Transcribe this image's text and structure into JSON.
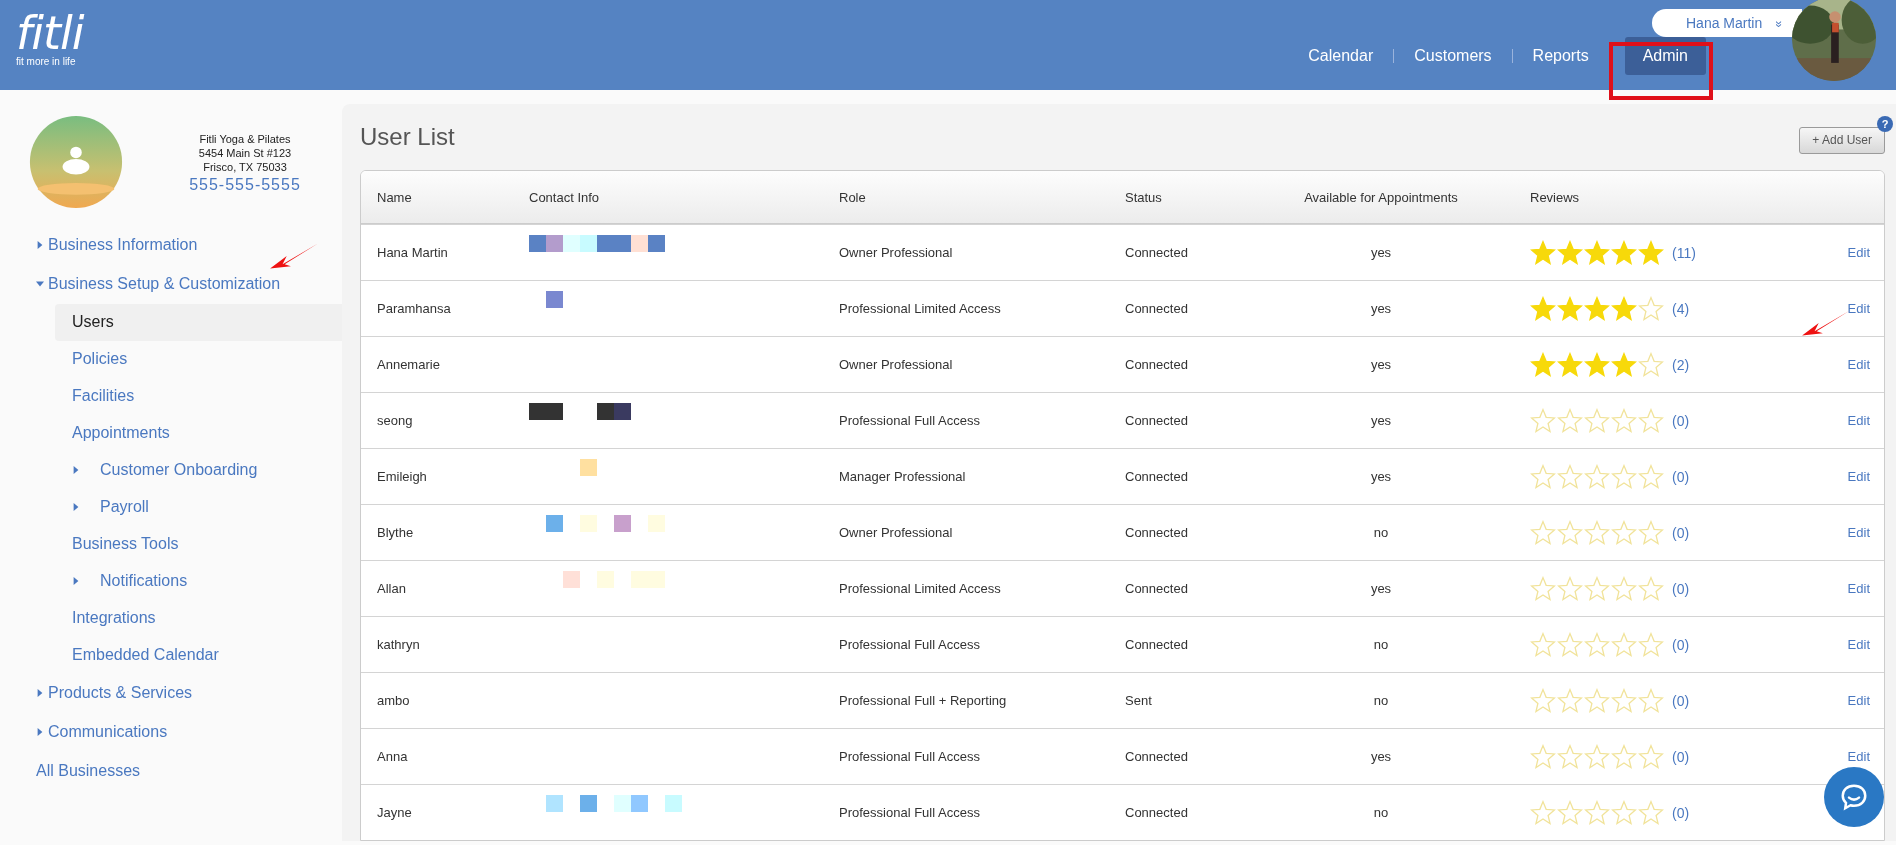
{
  "header": {
    "logo": "fitli",
    "tagline": "fit more in life",
    "user": "Hana Martin",
    "user_caret": "»",
    "nav": [
      {
        "label": "Calendar",
        "selected": false
      },
      {
        "label": "Customers",
        "selected": false
      },
      {
        "label": "Reports",
        "selected": false
      },
      {
        "label": "Admin",
        "selected": true
      }
    ]
  },
  "business": {
    "name": "Fitli Yoga & Pilates",
    "address": "5454 Main St #123",
    "city": "Frisco, TX 75033",
    "phone": "555-555-5555"
  },
  "sidebar": {
    "items": [
      {
        "label": "Business Information",
        "kind": "group",
        "expanded": false,
        "selected": false
      },
      {
        "label": "Business Setup & Customization",
        "kind": "group",
        "expanded": true,
        "selected": false,
        "children": [
          {
            "label": "Users",
            "kind": "link",
            "selected": true
          },
          {
            "label": "Policies",
            "kind": "link",
            "selected": false
          },
          {
            "label": "Facilities",
            "kind": "link",
            "selected": false
          },
          {
            "label": "Appointments",
            "kind": "link",
            "selected": false
          },
          {
            "label": "Customer Onboarding",
            "kind": "group",
            "expanded": false,
            "selected": false
          },
          {
            "label": "Payroll",
            "kind": "group",
            "expanded": false,
            "selected": false
          },
          {
            "label": "Business Tools",
            "kind": "link",
            "selected": false
          },
          {
            "label": "Notifications",
            "kind": "group",
            "expanded": false,
            "selected": false
          },
          {
            "label": "Integrations",
            "kind": "link",
            "selected": false
          },
          {
            "label": "Embedded Calendar",
            "kind": "link",
            "selected": false
          }
        ]
      },
      {
        "label": "Products & Services",
        "kind": "group",
        "expanded": false,
        "selected": false
      },
      {
        "label": "Communications",
        "kind": "group",
        "expanded": false,
        "selected": false
      },
      {
        "label": "All Businesses",
        "kind": "link",
        "selected": false
      }
    ]
  },
  "page": {
    "title": "User List",
    "add_button": "+ Add User",
    "help": "?"
  },
  "table": {
    "columns": [
      "Name",
      "Contact Info",
      "Role",
      "Status",
      "Available for Appointments",
      "Reviews"
    ],
    "rows": [
      {
        "name": "Hana Martin",
        "role": "Owner Professional",
        "status": "Connected",
        "available": "yes",
        "stars": 5,
        "count": "(11)",
        "action": "Edit"
      },
      {
        "name": "Paramhansa",
        "role": "Professional Limited Access",
        "status": "Connected",
        "available": "yes",
        "stars": 4,
        "count": "(4)",
        "action": "Edit"
      },
      {
        "name": "Annemarie",
        "role": "Owner Professional",
        "status": "Connected",
        "available": "yes",
        "stars": 4,
        "count": "(2)",
        "action": "Edit"
      },
      {
        "name": "seong",
        "role": "Professional Full Access",
        "status": "Connected",
        "available": "yes",
        "stars": 0,
        "count": "(0)",
        "action": "Edit"
      },
      {
        "name": "Emileigh",
        "role": "Manager Professional",
        "status": "Connected",
        "available": "yes",
        "stars": 0,
        "count": "(0)",
        "action": "Edit"
      },
      {
        "name": "Blythe",
        "role": "Owner Professional",
        "status": "Connected",
        "available": "no",
        "stars": 0,
        "count": "(0)",
        "action": "Edit"
      },
      {
        "name": "Allan",
        "role": "Professional Limited Access",
        "status": "Connected",
        "available": "yes",
        "stars": 0,
        "count": "(0)",
        "action": "Edit"
      },
      {
        "name": "kathryn",
        "role": "Professional Full Access",
        "status": "Connected",
        "available": "no",
        "stars": 0,
        "count": "(0)",
        "action": "Edit"
      },
      {
        "name": "ambo",
        "role": "Professional Full + Reporting",
        "status": "Sent",
        "available": "no",
        "stars": 0,
        "count": "(0)",
        "action": "Edit"
      },
      {
        "name": "Anna",
        "role": "Professional Full Access",
        "status": "Connected",
        "available": "yes",
        "stars": 0,
        "count": "(0)",
        "action": "Edit"
      },
      {
        "name": "Jayne",
        "role": "Professional Full Access",
        "status": "Connected",
        "available": "no",
        "stars": 0,
        "count": "(0)"
      }
    ]
  }
}
